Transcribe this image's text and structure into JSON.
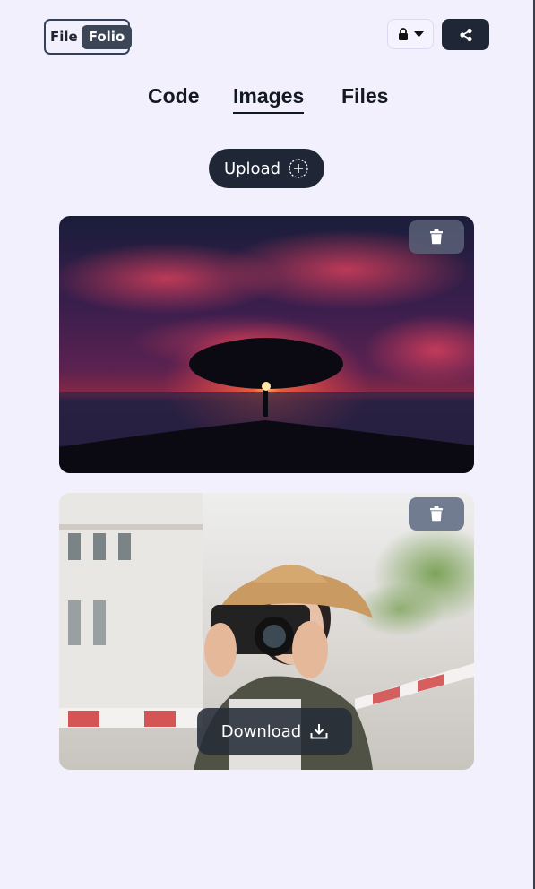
{
  "logo": {
    "part1": "File",
    "part2": "Folio"
  },
  "header": {
    "lock_icon": "lock-icon",
    "share_icon": "share-icon"
  },
  "tabs": [
    {
      "label": "Code",
      "active": false
    },
    {
      "label": "Images",
      "active": true
    },
    {
      "label": "Files",
      "active": false
    }
  ],
  "upload": {
    "label": "Upload",
    "icon": "plus-circle-icon"
  },
  "images": [
    {
      "alt": "sunset-tree-photo",
      "delete_icon": "trash-icon"
    },
    {
      "alt": "photographer-woman-photo",
      "delete_icon": "trash-icon",
      "download_label": "Download"
    }
  ],
  "colors": {
    "background": "#f1f0fc",
    "dark": "#1f2737",
    "text": "#141821"
  }
}
